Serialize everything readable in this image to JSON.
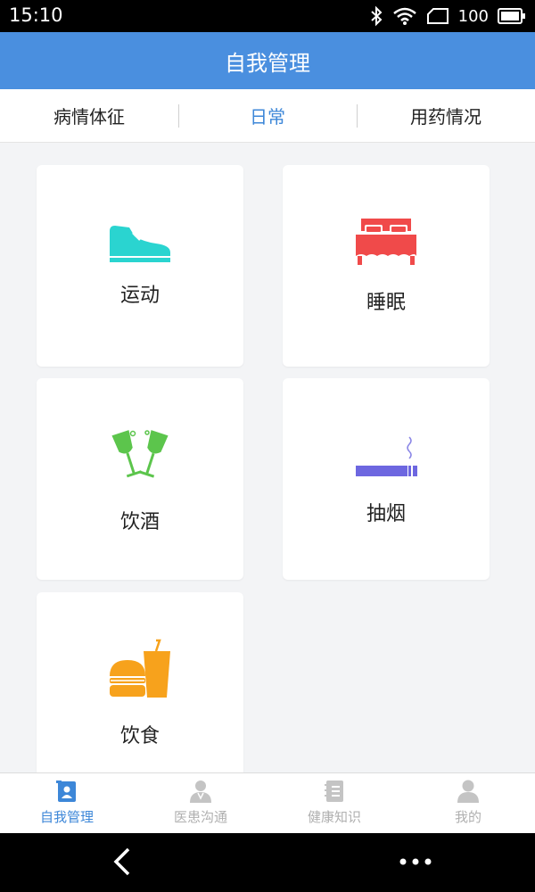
{
  "status_bar": {
    "time": "15:10",
    "battery": "100",
    "icons": [
      "bluetooth-icon",
      "wifi-icon",
      "signal-icon",
      "battery-icon"
    ]
  },
  "header": {
    "title": "自我管理",
    "color": "#4a8fdf"
  },
  "tabs": [
    {
      "label": "病情体征",
      "active": false
    },
    {
      "label": "日常",
      "active": true
    },
    {
      "label": "用药情况",
      "active": false
    }
  ],
  "cards": [
    {
      "label": "运动",
      "icon": "sneaker-icon",
      "color": "#2ad4d0"
    },
    {
      "label": "睡眠",
      "icon": "bed-icon",
      "color": "#f04a4a"
    },
    {
      "label": "饮酒",
      "icon": "wine-glasses-icon",
      "color": "#5cc54c"
    },
    {
      "label": "抽烟",
      "icon": "cigarette-icon",
      "color": "#6d67e0"
    },
    {
      "label": "饮食",
      "icon": "burger-drink-icon",
      "color": "#f7a21c"
    }
  ],
  "bottom_nav": [
    {
      "label": "自我管理",
      "icon": "self-management-icon",
      "active": true
    },
    {
      "label": "医患沟通",
      "icon": "doctor-icon",
      "active": false
    },
    {
      "label": "健康知识",
      "icon": "notebook-icon",
      "active": false
    },
    {
      "label": "我的",
      "icon": "person-icon",
      "active": false
    }
  ],
  "accent_color": "#3d87d8"
}
